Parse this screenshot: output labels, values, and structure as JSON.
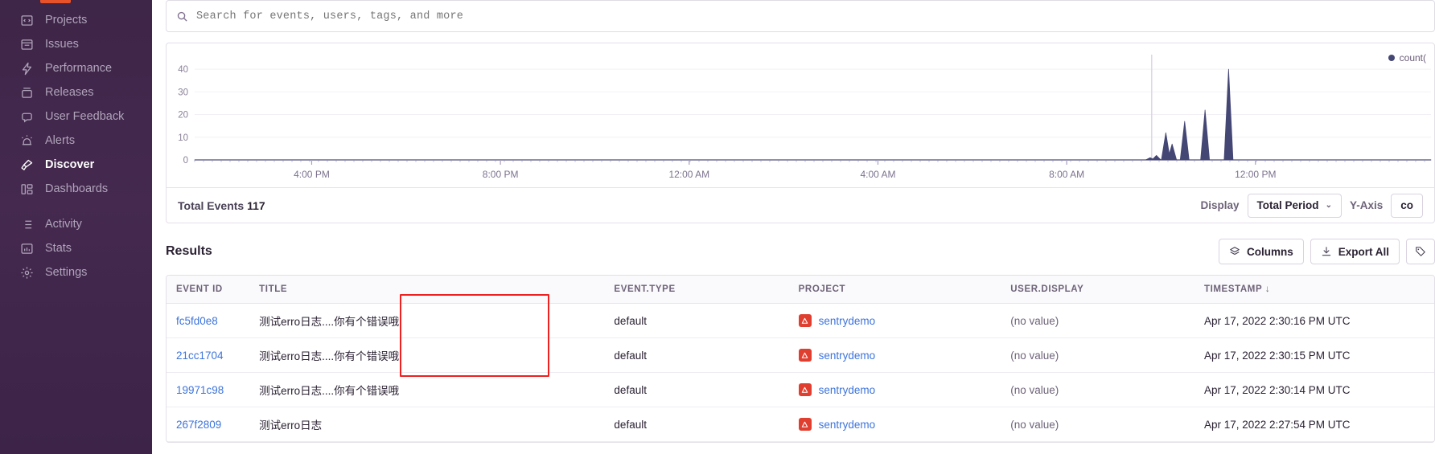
{
  "sidebar": {
    "items": [
      {
        "label": "Projects",
        "icon": "projects-icon",
        "active": false
      },
      {
        "label": "Issues",
        "icon": "issues-icon",
        "active": false
      },
      {
        "label": "Performance",
        "icon": "performance-icon",
        "active": false
      },
      {
        "label": "Releases",
        "icon": "releases-icon",
        "active": false
      },
      {
        "label": "User Feedback",
        "icon": "user-feedback-icon",
        "active": false
      },
      {
        "label": "Alerts",
        "icon": "alerts-icon",
        "active": false
      },
      {
        "label": "Discover",
        "icon": "discover-icon",
        "active": true
      },
      {
        "label": "Dashboards",
        "icon": "dashboards-icon",
        "active": false
      },
      {
        "label": "Activity",
        "icon": "activity-icon",
        "active": false
      },
      {
        "label": "Stats",
        "icon": "stats-icon",
        "active": false
      },
      {
        "label": "Settings",
        "icon": "settings-icon",
        "active": false
      }
    ]
  },
  "search": {
    "placeholder": "Search for events, users, tags, and more",
    "value": "",
    "icon": "search-icon"
  },
  "chart_data": {
    "type": "area",
    "title": "",
    "xlabel": "",
    "ylabel": "",
    "ylim": [
      0,
      45
    ],
    "yticks": [
      0,
      10,
      20,
      30,
      40
    ],
    "xticks": [
      "4:00 PM",
      "8:00 PM",
      "12:00 AM",
      "4:00 AM",
      "8:00 AM",
      "12:00 PM"
    ],
    "grid": true,
    "legend": [
      "count("
    ],
    "legend_position": "top-right",
    "series_color": "#444674",
    "series": [
      {
        "name": "count(",
        "x": [
          "4:00 PM",
          "8:00 PM",
          "12:00 AM",
          "4:00 AM",
          "8:00 AM",
          "12:00 PM"
        ],
        "points": [
          {
            "t": 1218,
            "v": 1
          },
          {
            "t": 1226,
            "v": 2
          },
          {
            "t": 1238,
            "v": 12
          },
          {
            "t": 1246,
            "v": 7
          },
          {
            "t": 1262,
            "v": 17
          },
          {
            "t": 1288,
            "v": 22
          },
          {
            "t": 1318,
            "v": 40
          }
        ]
      }
    ],
    "marker_line_x": 1220
  },
  "panel_footer": {
    "total_events_label": "Total Events",
    "total_events_value": "117",
    "display_label": "Display",
    "display_value": "Total Period",
    "yaxis_label": "Y-Axis",
    "yaxis_value": "co"
  },
  "results": {
    "title": "Results",
    "actions": [
      {
        "label": "Columns",
        "icon": "stack-icon"
      },
      {
        "label": "Export All",
        "icon": "download-icon"
      },
      {
        "label": "",
        "icon": "tag-icon"
      }
    ],
    "columns": [
      "EVENT ID",
      "TITLE",
      "EVENT.TYPE",
      "PROJECT",
      "USER.DISPLAY",
      "TIMESTAMP"
    ],
    "sorted_column": "TIMESTAMP",
    "sort_indicator": "↓",
    "rows": [
      {
        "event_id": "fc5fd0e8",
        "title": "测试erro日志....你有个错误哦",
        "event_type": "default",
        "project": "sentrydemo",
        "user_display": "(no value)",
        "timestamp": "Apr 17, 2022 2:30:16 PM UTC"
      },
      {
        "event_id": "21cc1704",
        "title": "测试erro日志....你有个错误哦",
        "event_type": "default",
        "project": "sentrydemo",
        "user_display": "(no value)",
        "timestamp": "Apr 17, 2022 2:30:15 PM UTC"
      },
      {
        "event_id": "19971c98",
        "title": "测试erro日志....你有个错误哦",
        "event_type": "default",
        "project": "sentrydemo",
        "user_display": "(no value)",
        "timestamp": "Apr 17, 2022 2:30:14 PM UTC"
      },
      {
        "event_id": "267f2809",
        "title": "测试erro日志",
        "event_type": "default",
        "project": "sentrydemo",
        "user_display": "(no value)",
        "timestamp": "Apr 17, 2022 2:27:54 PM UTC"
      }
    ]
  },
  "annotation": {
    "type": "rectangle-highlight",
    "color": "#ee2020"
  },
  "colors": {
    "sidebar_bg": "#452a4f",
    "accent_link": "#3d74db",
    "chart_series": "#444674",
    "project_badge": "#e03e2f",
    "annotation": "#ee2020"
  }
}
